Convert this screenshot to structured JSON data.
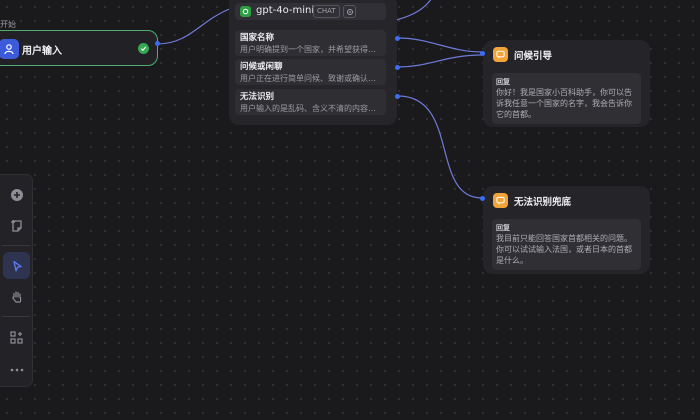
{
  "start": {
    "section_label": "开始",
    "title": "用户输入",
    "icon": "user-icon",
    "status_icon": "check-circle-icon"
  },
  "classifier": {
    "model_name": "gpt-4o-mini",
    "model_mode_badge": "CHAT",
    "model_icon": "openai-icon",
    "settings_icon": "model-settings-icon",
    "classes": [
      {
        "name": "国家名称",
        "desc": "用户明确提到一个国家，并希望获得该国的首都信息"
      },
      {
        "name": "问候或闲聊",
        "desc": "用户正在进行简单问候、致谢或确认等闲聊"
      },
      {
        "name": "无法识别",
        "desc": "用户输入的是乱码、含义不清的内容或其他"
      }
    ]
  },
  "answers": [
    {
      "title": "问候引导",
      "label": "回复",
      "text": "你好！我是国家小百科助手，你可以告诉我任意一个国家的名字，我会告诉你它的首都。",
      "icon": "answer-icon"
    },
    {
      "title": "无法识别兜底",
      "label": "回复",
      "text": "我目前只能回答国家首都相关的问题。你可以试试输入法国，或者日本的首都是什么。",
      "icon": "answer-icon"
    }
  ],
  "toolbar": {
    "items": [
      "add-node-icon",
      "add-note-icon",
      "pointer-icon",
      "hand-icon",
      "organize-icon",
      "more-icon"
    ],
    "active": "pointer-icon"
  },
  "colors": {
    "canvas_bg": "#1a1a1d",
    "edge": "#6e7bd8",
    "start_border": "#4caf6e",
    "user_icon_bg": "#3b5bdb",
    "answer_icon_bg": "#f0a43a",
    "model_icon_bg": "#2ea043",
    "success": "#34a853"
  }
}
